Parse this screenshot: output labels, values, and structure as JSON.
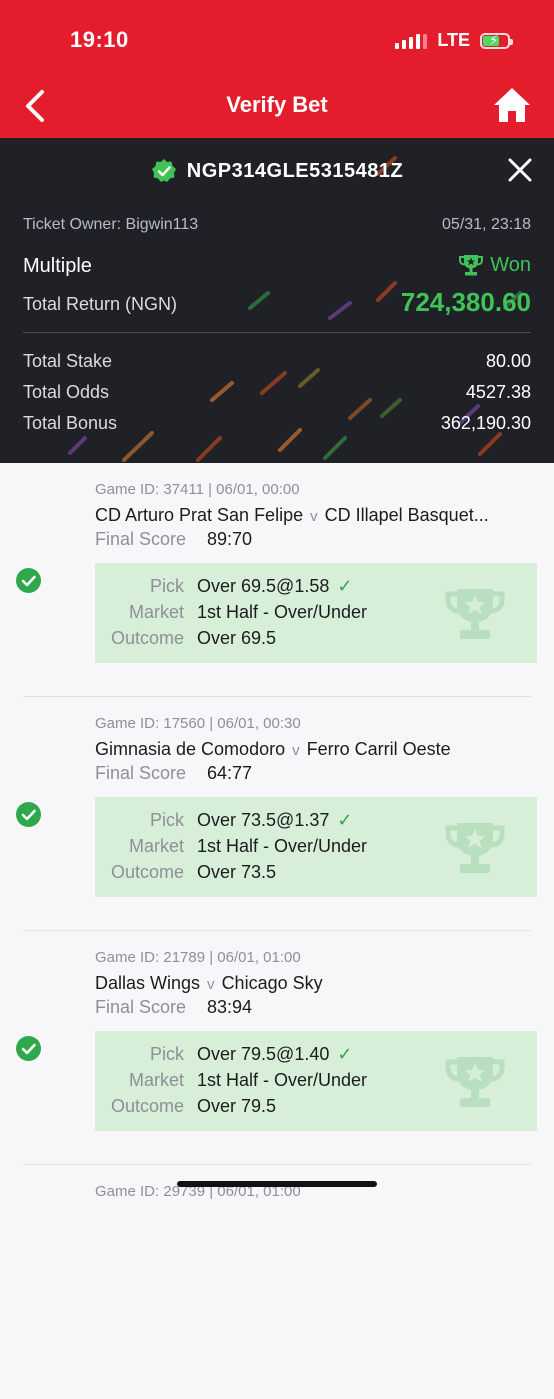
{
  "status_bar": {
    "time": "19:10",
    "network": "LTE",
    "signal_bars": 4,
    "battery_icon": "battery-charging-icon"
  },
  "header": {
    "title": "Verify Bet",
    "back_icon": "chevron-left-icon",
    "home_icon": "home-icon",
    "background": "#e41d2c"
  },
  "summary": {
    "ticket_id": "NGP314GLE5315481Z",
    "verified_icon": "verified-badge-icon",
    "close_icon": "close-icon",
    "owner": "Ticket Owner: Bigwin113",
    "date": "05/31, 23:18",
    "bet_type": "Multiple",
    "status": "Won",
    "status_icon": "trophy-icon",
    "return_label": "Total Return (NGN)",
    "return_value": "724,380.60",
    "rows": [
      {
        "label": "Total Stake",
        "value": "80.00"
      },
      {
        "label": "Total Odds",
        "value": "4527.38"
      },
      {
        "label": "Total Bonus",
        "value": "362,190.30"
      }
    ],
    "accent_green": "#3fc256"
  },
  "selections": [
    {
      "meta": "Game ID: 37411 | 06/01, 00:00",
      "home": "CD Arturo Prat San Felipe",
      "vs": "v",
      "away": "CD Illapel Basquet...",
      "score_label": "Final Score",
      "score": "89:70",
      "pick_label": "Pick",
      "pick": "Over 69.5@1.58",
      "market_label": "Market",
      "market": "1st Half - Over/Under",
      "outcome_label": "Outcome",
      "outcome": "Over 69.5"
    },
    {
      "meta": "Game ID: 17560 | 06/01, 00:30",
      "home": "Gimnasia de Comodoro",
      "vs": "v",
      "away": "Ferro Carril Oeste",
      "score_label": "Final Score",
      "score": "64:77",
      "pick_label": "Pick",
      "pick": "Over 73.5@1.37",
      "market_label": "Market",
      "market": "1st Half - Over/Under",
      "outcome_label": "Outcome",
      "outcome": "Over 73.5"
    },
    {
      "meta": "Game ID: 21789 | 06/01, 01:00",
      "home": "Dallas Wings",
      "vs": "v",
      "away": "Chicago Sky",
      "score_label": "Final Score",
      "score": "83:94",
      "pick_label": "Pick",
      "pick": "Over 79.5@1.40",
      "market_label": "Market",
      "market": "1st Half - Over/Under",
      "outcome_label": "Outcome",
      "outcome": "Over 79.5"
    },
    {
      "meta": "Game ID: 29739 | 06/01, 01:00"
    }
  ],
  "check_mark": "✓"
}
